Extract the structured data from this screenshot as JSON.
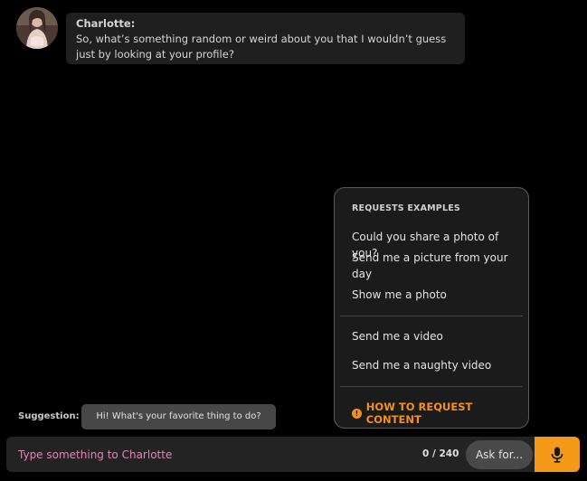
{
  "message": {
    "sender": "Charlotte:",
    "text": "So, what’s something random or weird about you that I wouldn’t guess just by looking at your profile?",
    "avatar_icon": "avatar-photo"
  },
  "requests": {
    "heading": "REQUESTS EXAMPLES",
    "photo_items": [
      "Could you share a photo of you?",
      "Send me a picture from your day",
      "Show me a photo"
    ],
    "video_items": [
      "Send me a video",
      "Send me a naughty video"
    ],
    "how_to": "HOW TO REQUEST CONTENT",
    "how_to_icon": "info-icon",
    "accent_color": "#f5901e"
  },
  "suggestion": {
    "label": "Suggestion:",
    "chip": "Hi! What's your favorite thing to do?"
  },
  "composer": {
    "placeholder": "Type something to Charlotte",
    "value": "",
    "counter": "0 / 240",
    "ask_label": "Ask for...",
    "mic_icon": "microphone-icon",
    "mic_color": "#f59a18"
  }
}
